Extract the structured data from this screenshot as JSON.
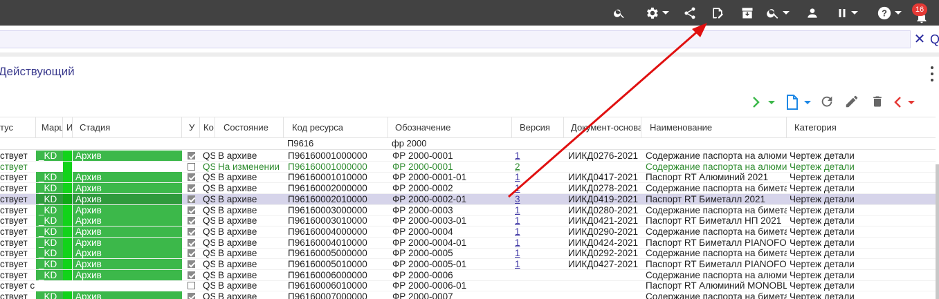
{
  "topbar": {
    "notif_count": "16",
    "icons": [
      "search-icon",
      "gear-icon",
      "share-icon",
      "edit-document-icon",
      "archive-icon",
      "search-dropdown-icon",
      "user-icon",
      "pause-icon",
      "help-icon",
      "bell-icon"
    ]
  },
  "search": {
    "close_glyph": "✕"
  },
  "panel": {
    "title": "Действующий"
  },
  "columns": {
    "status": "тус",
    "route": "Марш",
    "info": "И",
    "stage": "Стадия",
    "u": "У",
    "code": "Ко",
    "state": "Состояние",
    "resource_code": "Код ресурса",
    "designation": "Обозначение",
    "version": "Версия",
    "base_doc": "Документ-основа",
    "name": "Наименование",
    "category": "Категория"
  },
  "filters": {
    "resource_code": "П9616",
    "designation": "фр 2000"
  },
  "rows": [
    {
      "status": "ствует",
      "route": "_KD",
      "stage": "Архив",
      "checked": true,
      "code": "QS",
      "state": "В архиве",
      "resource_code": "П96160001000000",
      "designation": "ФР 2000-0001",
      "version": "1",
      "base_doc": "ИИКД0276-2021",
      "name": "Содержание паспорта на алюми",
      "category": "Чертеж детали",
      "kind": "archive"
    },
    {
      "status": "ствует",
      "route": "",
      "stage": "",
      "checked": false,
      "code": "QS",
      "state": "На изменении",
      "resource_code": "П96160001000000",
      "designation": "ФР 2000-0001",
      "version": "2",
      "base_doc": "",
      "name": "Содержание паспорта на алюми",
      "category": "Чертеж детали",
      "kind": "changing"
    },
    {
      "status": "ствует",
      "route": "_KD",
      "stage": "Архив",
      "checked": true,
      "code": "QS",
      "state": "В архиве",
      "resource_code": "П96160001010000",
      "designation": "ФР 2000-0001-01",
      "version": "1",
      "base_doc": "ИИКД0417-2021",
      "name": "Паспорт RT Алюминий 2021",
      "category": "Чертеж детали",
      "kind": "archive"
    },
    {
      "status": "ствует",
      "route": "_KD",
      "stage": "Архив",
      "checked": true,
      "code": "QS",
      "state": "В архиве",
      "resource_code": "П96160002000000",
      "designation": "ФР 2000-0002",
      "version": "1",
      "base_doc": "ИИКД0278-2021",
      "name": "Содержание паспорта на биметал",
      "category": "Чертеж детали",
      "kind": "archive"
    },
    {
      "status": "ствует",
      "route": "_KD",
      "stage": "Архив",
      "checked": true,
      "code": "QS",
      "state": "В архиве",
      "resource_code": "П96160002010000",
      "designation": "ФР 2000-0002-01",
      "version": "3",
      "base_doc": "ИИКД0419-2021",
      "name": "Паспорт RT Биметалл 2021",
      "category": "Чертеж детали",
      "kind": "selected"
    },
    {
      "status": "ствует",
      "route": "_KD",
      "stage": "Архив",
      "checked": true,
      "code": "QS",
      "state": "В архиве",
      "resource_code": "П96160003000000",
      "designation": "ФР 2000-0003",
      "version": "1",
      "base_doc": "ИИКД0280-2021",
      "name": "Содержание паспорта на биметал",
      "category": "Чертеж детали",
      "kind": "archive"
    },
    {
      "status": "ствует",
      "route": "_KD",
      "stage": "Архив",
      "checked": true,
      "code": "QS",
      "state": "В архиве",
      "resource_code": "П96160003010000",
      "designation": "ФР 2000-0003-01",
      "version": "1",
      "base_doc": "ИИКД0421-2021",
      "name": "Паспорт RT Биметалл НП 2021",
      "category": "Чертеж детали",
      "kind": "archive"
    },
    {
      "status": "ствует",
      "route": "_KD",
      "stage": "Архив",
      "checked": true,
      "code": "QS",
      "state": "В архиве",
      "resource_code": "П96160004000000",
      "designation": "ФР 2000-0004",
      "version": "1",
      "base_doc": "ИИКД0290-2021",
      "name": "Содержание паспорта на биметал",
      "category": "Чертеж детали",
      "kind": "archive"
    },
    {
      "status": "ствует",
      "route": "_KD",
      "stage": "Архив",
      "checked": true,
      "code": "QS",
      "state": "В архиве",
      "resource_code": "П96160004010000",
      "designation": "ФР 2000-0004-01",
      "version": "1",
      "base_doc": "ИИКД0424-2021",
      "name": "Паспорт RT Биметалл PIANOFOR",
      "category": "Чертеж детали",
      "kind": "archive"
    },
    {
      "status": "ствует",
      "route": "_KD",
      "stage": "Архив",
      "checked": true,
      "code": "QS",
      "state": "В архиве",
      "resource_code": "П96160005000000",
      "designation": "ФР 2000-0005",
      "version": "1",
      "base_doc": "ИИКД0292-2021",
      "name": "Содержание паспорта на биметал",
      "category": "Чертеж детали",
      "kind": "archive"
    },
    {
      "status": "ствует",
      "route": "_KD",
      "stage": "Архив",
      "checked": true,
      "code": "QS",
      "state": "В архиве",
      "resource_code": "П96160005010000",
      "designation": "ФР 2000-0005-01",
      "version": "1",
      "base_doc": "ИИКД0427-2021",
      "name": "Паспорт RT Биметалл PIANOFOR",
      "category": "Чертеж детали",
      "kind": "archive"
    },
    {
      "status": "ствует",
      "route": "_KD",
      "stage": "Архив",
      "checked": true,
      "code": "QS",
      "state": "В архиве",
      "resource_code": "П96160006000000",
      "designation": "ФР 2000-0006",
      "version": "",
      "base_doc": "",
      "name": "Содержание паспорта на алюми",
      "category": "Чертеж детали",
      "kind": "archive"
    },
    {
      "status": "ствует с с",
      "route": "",
      "stage": "",
      "checked": false,
      "code": "QS",
      "state": "В архиве",
      "resource_code": "П96160006010000",
      "designation": "ФР 2000-0006-01",
      "version": "",
      "base_doc": "",
      "name": "Паспорт RT Алюминий MONOBL",
      "category": "Чертеж детали",
      "kind": "plain"
    },
    {
      "status": "ствует",
      "route": "_KD",
      "stage": "Архив",
      "checked": true,
      "code": "QS",
      "state": "В архиве",
      "resource_code": "П96160007000000",
      "designation": "ФР 2000-0007",
      "version": "",
      "base_doc": "",
      "name": "Содержание паспорта на биметал",
      "category": "Чертеж детали",
      "kind": "archive"
    }
  ],
  "colors": {
    "topbar": "#424242",
    "archive_green": "#3cb84a",
    "bright_green": "#12d31a",
    "changing_text": "#2e8b2e",
    "selected_row": "#d6d4ea",
    "link": "#3f37a5",
    "annotation_arrow": "#e01010"
  }
}
